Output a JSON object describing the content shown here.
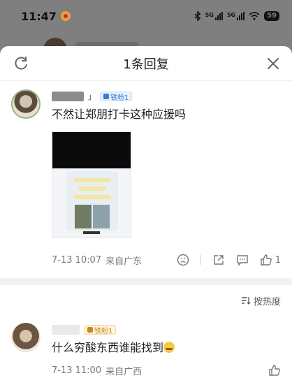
{
  "status_bar": {
    "time": "11:47",
    "signal_label_1": "5G",
    "signal_label_2": "5G",
    "battery": "59"
  },
  "sheet": {
    "title": "1条回复"
  },
  "comments": [
    {
      "name_suffix": "」",
      "badge": "铁粉1",
      "text": "不然让郑朋打卡这种应援吗",
      "date": "7-13 10:07",
      "location": "来自广东",
      "like_count": "1"
    },
    {
      "badge": "铁粉1",
      "text": "什么穷酸东西谁能找到",
      "date": "7-13 11:00",
      "location": "来自广西"
    }
  ],
  "sort": {
    "label": "按热度"
  },
  "colors": {
    "badge_blue": "#3a7bd5",
    "badge_gold": "#c98a1b",
    "dim_overlay": "#7f7f7f"
  }
}
